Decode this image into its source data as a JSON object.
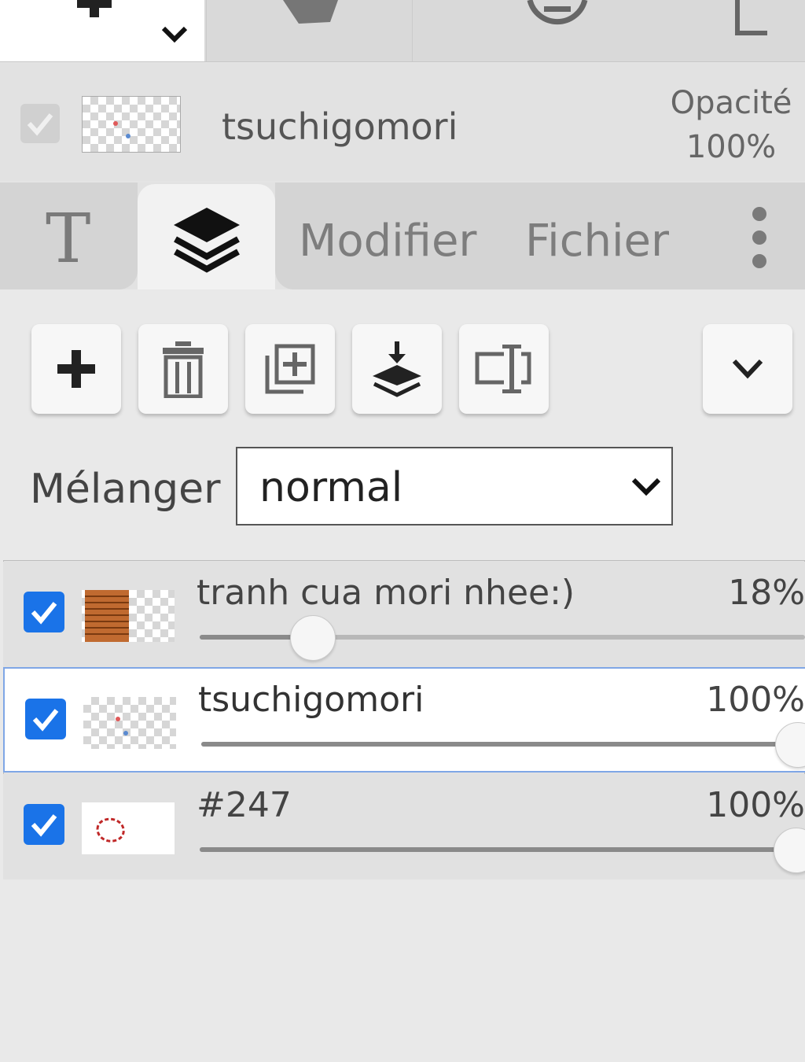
{
  "toolbar": {
    "items": [
      "text-tool-icon",
      "shape-tool-icon",
      "zoom-out-icon",
      "export-icon"
    ]
  },
  "current_layer": {
    "name": "tsuchigomori",
    "opacity_label": "Opacité",
    "opacity_value": "100%"
  },
  "tabs": {
    "text_tab_glyph": "T",
    "modify_label": "Modifier",
    "file_label": "Fichier"
  },
  "layer_actions": [
    "add-layer",
    "delete-layer",
    "duplicate-layer",
    "merge-down",
    "rename-layer",
    "more"
  ],
  "blend": {
    "label": "Mélanger",
    "value": "normal"
  },
  "layers": [
    {
      "name": "tranh cua mori nhee:)",
      "opacity": "18%",
      "opacity_value": 0.18,
      "visible": true,
      "selected": false
    },
    {
      "name": "tsuchigomori",
      "opacity": "100%",
      "opacity_value": 1.0,
      "visible": true,
      "selected": true
    },
    {
      "name": "#247",
      "opacity": "100%",
      "opacity_value": 1.0,
      "visible": true,
      "selected": false
    }
  ],
  "colors": {
    "accent": "#1a73e8",
    "selected_border": "#7fa6e6"
  }
}
